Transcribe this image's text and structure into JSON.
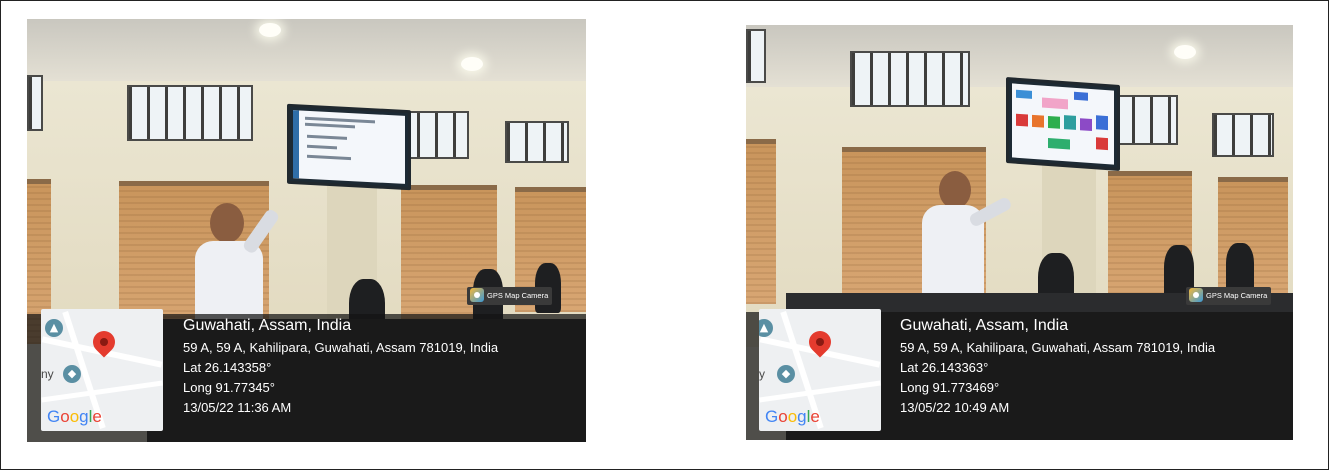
{
  "photos": [
    {
      "badge_label": "GPS Map Camera",
      "map_logo": "Google",
      "map_poi_label": "ny",
      "location_title": "Guwahati, Assam, India",
      "address": "59 A, 59 A, Kahilipara, Guwahati, Assam 781019, India",
      "latitude": "Lat 26.143358°",
      "longitude": "Long 91.77345°",
      "datetime": "13/05/22 11:36 AM"
    },
    {
      "badge_label": "GPS Map Camera",
      "map_logo": "Google",
      "map_poi_label": "y",
      "location_title": "Guwahati, Assam, India",
      "address": "59 A, 59 A, Kahilipara, Guwahati, Assam 781019, India",
      "latitude": "Lat 26.143363°",
      "longitude": "Long 91.773469°",
      "datetime": "13/05/22 10:49 AM"
    }
  ],
  "icons": [
    "map-pin-icon",
    "museum-icon",
    "education-icon",
    "gps-map-camera-icon"
  ],
  "colors": {
    "pin": "#e43b2e",
    "poi": "#5a8fa3",
    "caption_bg": "#141414"
  }
}
